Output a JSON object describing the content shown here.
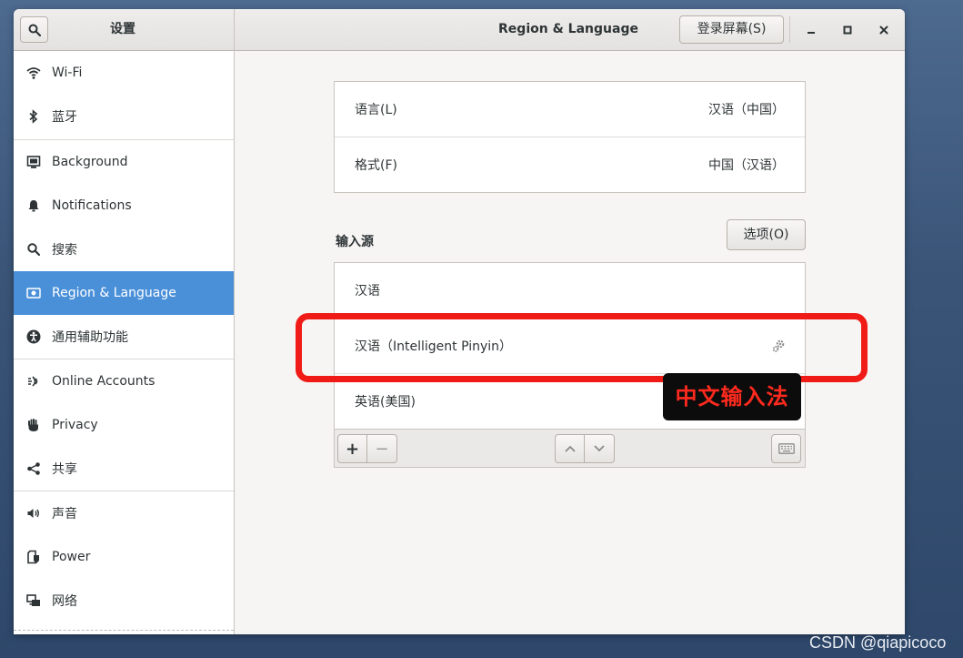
{
  "header": {
    "sidebar_title": "设置",
    "panel_title": "Region & Language",
    "login_screen_button": "登录屏幕(S)"
  },
  "sidebar": {
    "items": [
      {
        "label": "Wi-Fi",
        "icon": "wifi-icon"
      },
      {
        "label": "蓝牙",
        "icon": "bluetooth-icon"
      },
      {
        "label": "Background",
        "icon": "background-icon"
      },
      {
        "label": "Notifications",
        "icon": "bell-icon"
      },
      {
        "label": "搜索",
        "icon": "search-icon"
      },
      {
        "label": "Region & Language",
        "icon": "region-flag-icon",
        "active": true
      },
      {
        "label": "通用辅助功能",
        "icon": "accessibility-icon"
      },
      {
        "label": "Online Accounts",
        "icon": "online-accounts-icon"
      },
      {
        "label": "Privacy",
        "icon": "hand-icon"
      },
      {
        "label": "共享",
        "icon": "share-icon"
      },
      {
        "label": "声音",
        "icon": "speaker-icon"
      },
      {
        "label": "Power",
        "icon": "power-icon"
      },
      {
        "label": "网络",
        "icon": "network-icon"
      }
    ]
  },
  "language_format": {
    "language_label": "语言(L)",
    "language_value": "汉语（中国）",
    "formats_label": "格式(F)",
    "formats_value": "中国（汉语）"
  },
  "input_sources": {
    "title": "输入源",
    "options_button": "选项(O)",
    "items": [
      {
        "label": "汉语"
      },
      {
        "label": "汉语（Intelligent Pinyin）",
        "has_settings": true
      },
      {
        "label": "英语(美国)"
      }
    ],
    "add_symbol": "+",
    "remove_symbol": "−"
  },
  "annotation": {
    "label": "中文输入法",
    "color": "#f01b16"
  },
  "watermark": "CSDN @qiapicoco",
  "colors": {
    "accent": "#4a90d9",
    "annotation_red": "#f01b16"
  }
}
